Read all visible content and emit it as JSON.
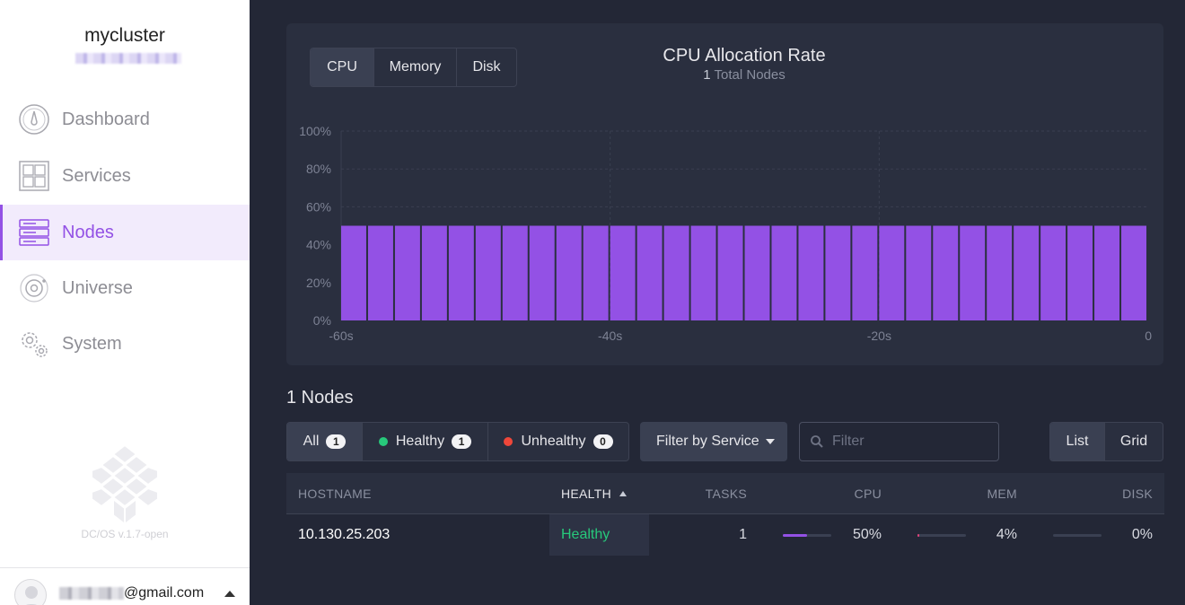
{
  "sidebar": {
    "cluster_name": "mycluster",
    "nav": [
      {
        "label": "Dashboard",
        "icon": "dashboard-icon",
        "active": false
      },
      {
        "label": "Services",
        "icon": "services-icon",
        "active": false
      },
      {
        "label": "Nodes",
        "icon": "nodes-icon",
        "active": true
      },
      {
        "label": "Universe",
        "icon": "universe-icon",
        "active": false
      },
      {
        "label": "System",
        "icon": "system-icon",
        "active": false
      }
    ],
    "version": "DC/OS v.1.7-open",
    "user_email_suffix": "@gmail.com"
  },
  "chart_panel": {
    "tabs": [
      "CPU",
      "Memory",
      "Disk"
    ],
    "selected_tab": "CPU",
    "title": "CPU Allocation Rate",
    "subtitle_count": "1",
    "subtitle_text": "Total Nodes"
  },
  "chart_data": {
    "type": "bar",
    "title": "CPU Allocation Rate",
    "y_ticks": [
      "100%",
      "80%",
      "60%",
      "40%",
      "20%",
      "0%"
    ],
    "x_ticks": [
      "-60s",
      "-40s",
      "-20s",
      "0"
    ],
    "ylim": [
      0,
      100
    ],
    "xlim": [
      -60,
      0
    ],
    "grid": true,
    "bar_count": 30,
    "values": [
      50,
      50,
      50,
      50,
      50,
      50,
      50,
      50,
      50,
      50,
      50,
      50,
      50,
      50,
      50,
      50,
      50,
      50,
      50,
      50,
      50,
      50,
      50,
      50,
      50,
      50,
      50,
      50,
      50,
      50
    ],
    "color": "#9351e5"
  },
  "nodes": {
    "count_label": "1 Nodes",
    "status_filters": [
      {
        "label": "All",
        "count": "1",
        "selected": true
      },
      {
        "label": "Healthy",
        "count": "1",
        "dot": "#27c97b"
      },
      {
        "label": "Unhealthy",
        "count": "0",
        "dot": "#ef473a"
      }
    ],
    "filter_service_label": "Filter by Service",
    "filter_placeholder": "Filter",
    "view_modes": [
      "List",
      "Grid"
    ],
    "selected_view": "List"
  },
  "table": {
    "headers": {
      "hostname": "HOSTNAME",
      "health": "HEALTH",
      "tasks": "TASKS",
      "cpu": "CPU",
      "mem": "MEM",
      "disk": "DISK"
    },
    "rows": [
      {
        "hostname": "10.130.25.203",
        "health": "Healthy",
        "tasks": "1",
        "cpu": "50%",
        "cpu_frac": 0.5,
        "mem": "4%",
        "mem_frac": 0.04,
        "disk": "0%",
        "disk_frac": 0
      }
    ]
  },
  "colors": {
    "accent": "#9351e5",
    "healthy": "#27c97b",
    "unhealthy": "#ef473a",
    "mem_bar": "#e0427a"
  }
}
